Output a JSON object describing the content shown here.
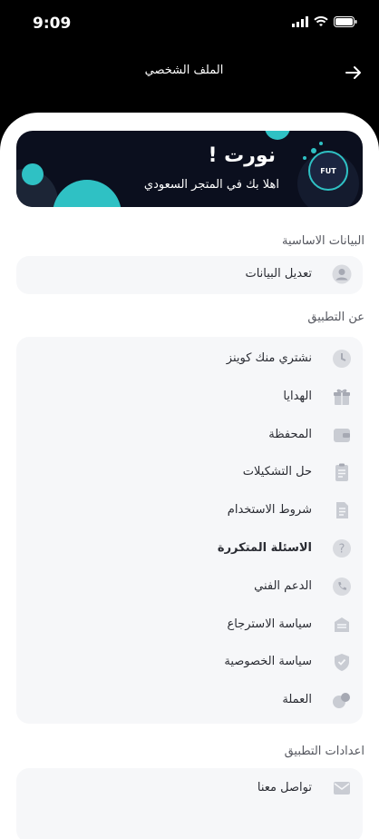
{
  "status": {
    "time": "9:09"
  },
  "appbar": {
    "title": "الملف الشخصي"
  },
  "banner": {
    "title": "نورت !",
    "subtitle": "اهلا بك في المتجر السعودي",
    "logo_text": "FUT",
    "accent": "#2fc1c4"
  },
  "sections": {
    "basic": {
      "title": "البيانات الاساسية",
      "items": [
        {
          "label": "تعديل البيانات",
          "icon": "user-icon"
        }
      ]
    },
    "about": {
      "title": "عن التطبيق",
      "items": [
        {
          "label": "نشتري منك كوينز",
          "icon": "clock-icon"
        },
        {
          "label": "الهدايا",
          "icon": "gift-icon"
        },
        {
          "label": "المحفظة",
          "icon": "wallet-icon"
        },
        {
          "label": "حل التشكيلات",
          "icon": "clipboard-icon"
        },
        {
          "label": "شروط الاستخدام",
          "icon": "document-icon"
        },
        {
          "label": "الاسئلة المتكررة",
          "icon": "question-icon"
        },
        {
          "label": "الدعم الفني",
          "icon": "phone-icon"
        },
        {
          "label": "سياسة الاسترجاع",
          "icon": "return-icon"
        },
        {
          "label": "سياسة الخصوصية",
          "icon": "shield-icon"
        },
        {
          "label": "العملة",
          "icon": "coins-icon"
        }
      ]
    },
    "settings": {
      "title": "اعدادات التطبيق",
      "items": [
        {
          "label": "تواصل معنا",
          "icon": "mail-icon"
        }
      ]
    }
  }
}
